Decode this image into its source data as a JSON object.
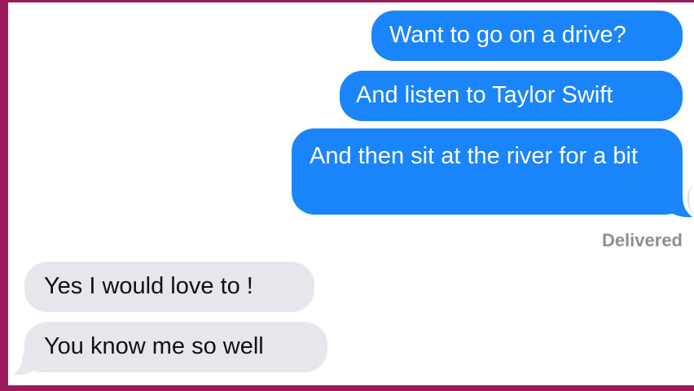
{
  "thread": {
    "sent": [
      {
        "text": "Want to go on a drive?"
      },
      {
        "text": "And listen to Taylor Swift"
      },
      {
        "text": "And then sit at the river for a bit"
      }
    ],
    "status": "Delivered",
    "received": [
      {
        "text": "Yes I would love to !"
      },
      {
        "text": "You know me so well"
      }
    ]
  },
  "colors": {
    "frame": "#9b1b5a",
    "sent_bubble": "#1a84fb",
    "received_bubble": "#e7e6ec",
    "status_text": "#8e8e93"
  }
}
